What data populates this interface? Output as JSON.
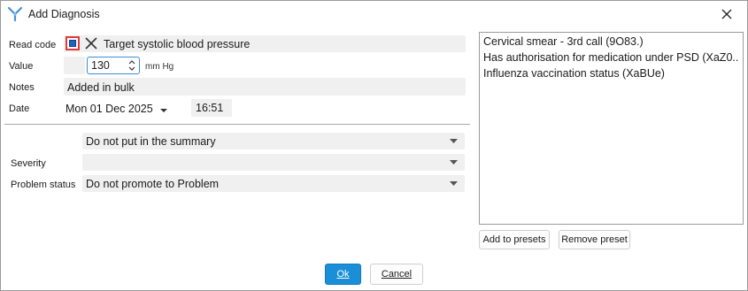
{
  "window": {
    "title": "Add Diagnosis"
  },
  "form": {
    "read_code_label": "Read code",
    "read_code_text": "Target systolic blood pressure",
    "value_label": "Value",
    "value": "130",
    "value_unit": "mm Hg",
    "notes_label": "Notes",
    "notes": "Added in bulk",
    "date_label": "Date",
    "date": "Mon 01 Dec 2025",
    "time": "16:51",
    "summary_option": "Do not put in the summary",
    "severity_label": "Severity",
    "severity": "",
    "problem_status_label": "Problem status",
    "problem_status": "Do not promote to Problem"
  },
  "presets": {
    "items": [
      {
        "label": "Cervical smear - 3rd call (9O83.)"
      },
      {
        "label": "Has authorisation for medication under PSD (XaZ0.."
      },
      {
        "label": "Influenza vaccination status (XaBUe)"
      }
    ],
    "add_label": "Add to presets",
    "remove_label": "Remove preset"
  },
  "footer": {
    "ok_label": "Ok",
    "cancel_label": "Cancel"
  },
  "colors": {
    "accent": "#1a8fd8",
    "focus_border": "#3c8dd8",
    "highlight_red": "#e03a3a",
    "field_bg": "#f0f0f0"
  },
  "icons": [
    "app-logo-icon",
    "close-icon",
    "clear-x-icon",
    "spin-up-icon",
    "spin-down-icon",
    "chevron-down-icon"
  ]
}
